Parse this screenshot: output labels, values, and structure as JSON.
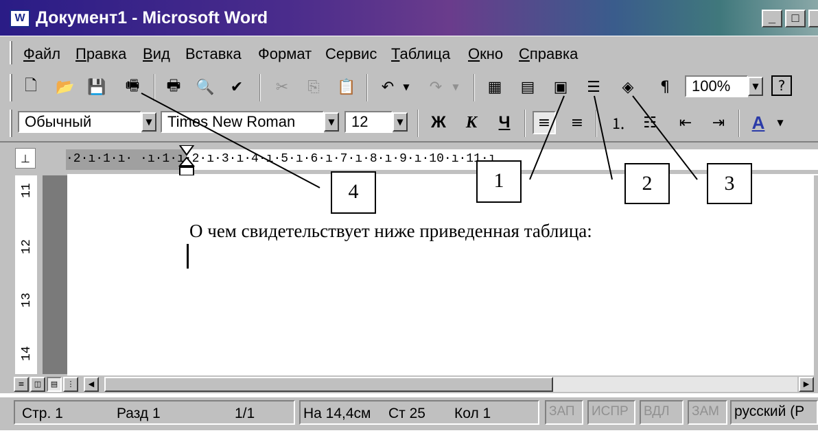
{
  "window": {
    "title": "Документ1 - Microsoft Word",
    "app_icon_glyph": "W",
    "minimize_glyph": "_",
    "maximize_glyph": "□"
  },
  "menu": {
    "items": [
      {
        "u": "Ф",
        "rest": "айл"
      },
      {
        "u": "П",
        "rest": "равка"
      },
      {
        "u": "В",
        "rest": "ид"
      },
      {
        "u": "",
        "rest": "Вставка"
      },
      {
        "u": "",
        "rest": "Формат"
      },
      {
        "u": "",
        "rest": "Сервис"
      },
      {
        "u": "Т",
        "rest": "аблица"
      },
      {
        "u": "О",
        "rest": "кно"
      },
      {
        "u": "С",
        "rest": "правка"
      }
    ]
  },
  "toolbar_standard": {
    "zoom": "100%",
    "pilcrow": "¶",
    "help": "?"
  },
  "toolbar_format": {
    "style": "Обычный",
    "font": "Times New Roman",
    "size": "12",
    "bold": "Ж",
    "italic": "К",
    "underline": "Ч",
    "font_color": "A"
  },
  "ruler": {
    "horizontal": "·2·ı·1·ı·  ·ı·1·ı·2·ı·3·ı·4·ı·5·ı·6·ı·7·ı·8·ı·9·ı·10·ı·11·ı",
    "vertical": [
      "11",
      "12",
      "13",
      "14"
    ]
  },
  "document": {
    "text": "О чем свидетельствует ниже приведенная таблица:"
  },
  "status": {
    "page": "Стр.  1",
    "section": "Разд  1",
    "pages": "1/1",
    "at": "На 14,4см",
    "line": "Ст  25",
    "col": "Кол  1",
    "rec": "ЗАП",
    "trk": "ИСПР",
    "ext": "ВДЛ",
    "ovr": "ЗАМ",
    "lang": "русский (Р"
  },
  "callouts": [
    "1",
    "2",
    "3",
    "4"
  ]
}
